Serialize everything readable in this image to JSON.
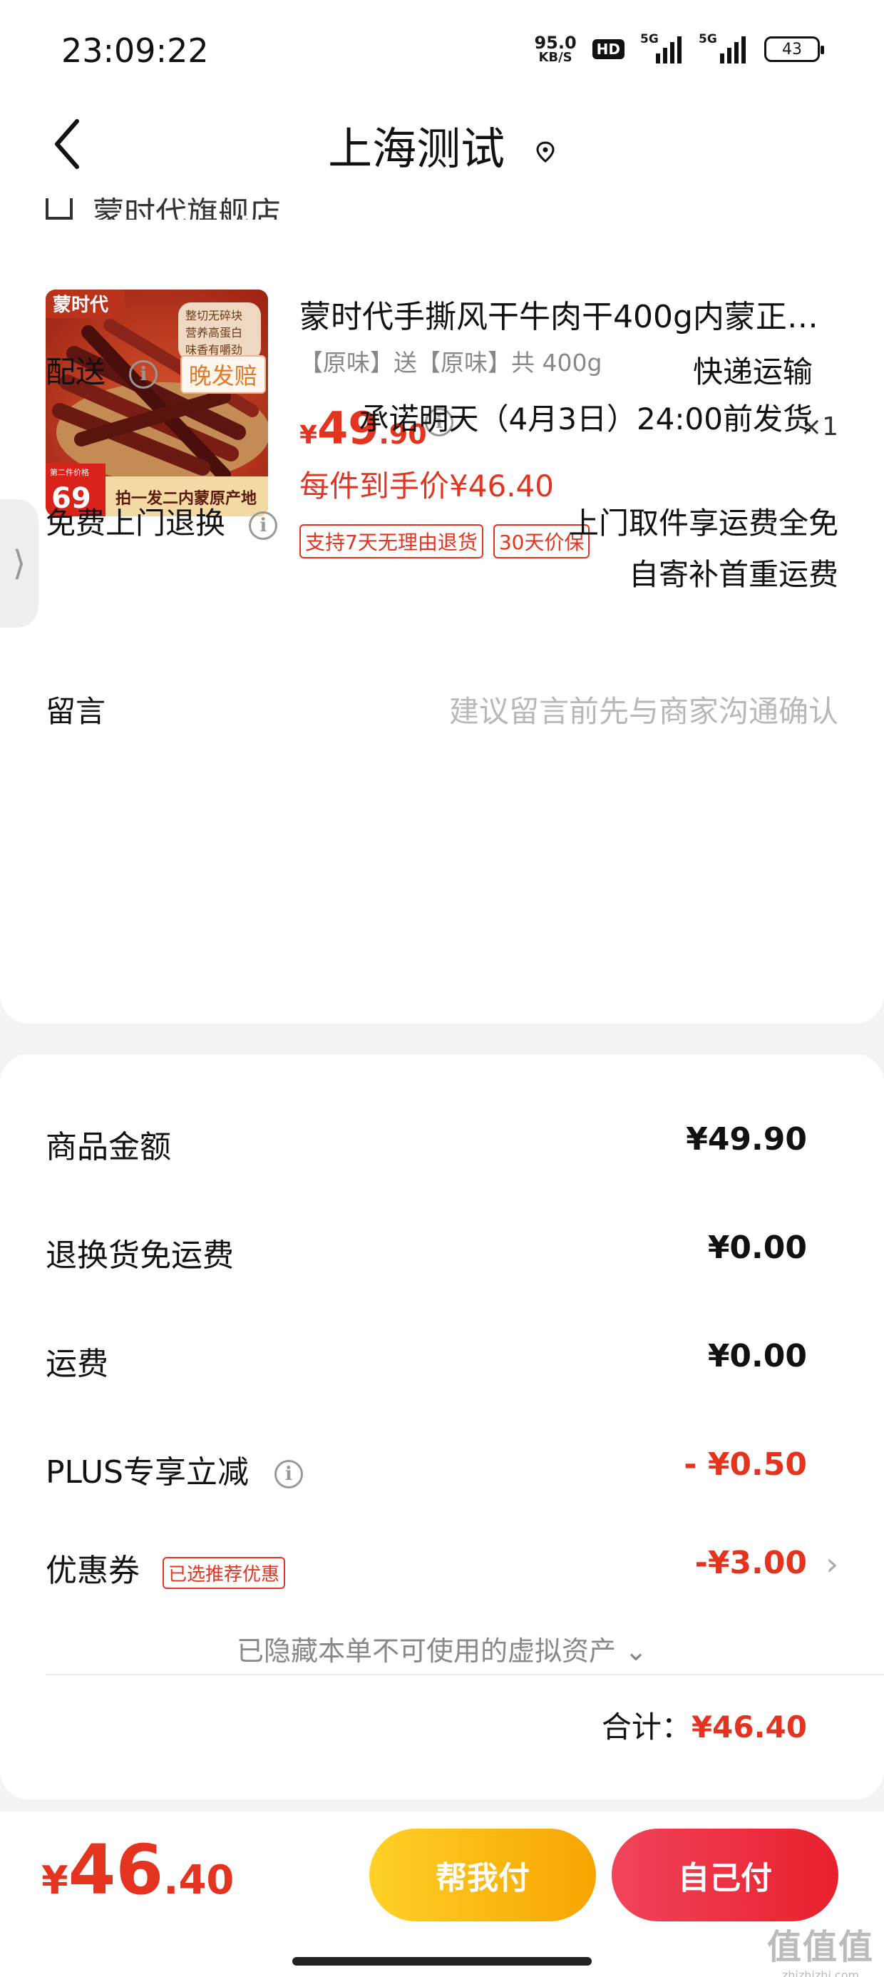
{
  "status_bar": {
    "time": "23:09:22",
    "net_speed_value": "95.0",
    "net_speed_unit": "KB/S",
    "hd_label": "HD",
    "signal1_label": "5G",
    "signal2_label": "5G",
    "battery": "43"
  },
  "header": {
    "title": "上海测试",
    "back_icon": "chevron-left-icon",
    "location_icon": "location-pin-icon"
  },
  "store": {
    "name": "蒙时代旗舰店"
  },
  "product": {
    "title": "蒙时代手撕风干牛肉干400g内蒙正…",
    "spec": "【原味】送【原味】共 400g",
    "price_symbol": "¥",
    "price_int": "49",
    "price_dec": ".90",
    "quantity": "×1",
    "unit_price": "每件到手价¥46.40",
    "tags": [
      "支持7天无理由退货",
      "30天价保"
    ],
    "image": {
      "brand": "蒙时代",
      "bubble_lines": [
        "整切无碎块",
        "营养高蛋白",
        "味香有嚼劲"
      ],
      "corner_small": "第二件价格",
      "corner_price": "69",
      "banner": "拍一发二内蒙原产地"
    }
  },
  "side_handle": {
    "glyph": "⟩"
  },
  "delivery": {
    "label": "配送",
    "badge": "晚发赔",
    "method": "快递运输",
    "promise": "承诺明天（4月3日）24:00前发货"
  },
  "returns": {
    "label": "免费上门退换",
    "line1": "上门取件享运费全免",
    "line2": "自寄补首重运费"
  },
  "message": {
    "label": "留言",
    "placeholder": "建议留言前先与商家沟通确认"
  },
  "amounts": {
    "goods_label": "商品金额",
    "goods_value": "¥49.90",
    "return_ship_label": "退换货免运费",
    "return_ship_value": "¥0.00",
    "shipping_label": "运费",
    "shipping_value": "¥0.00",
    "plus_label": "PLUS专享立减",
    "plus_value": "- ¥0.50",
    "coupon_label": "优惠券",
    "coupon_badge": "已选推荐优惠",
    "coupon_value": "-¥3.00",
    "hidden_note": "已隐藏本单不可使用的虚拟资产 ⌄",
    "total_label": "合计：",
    "total_value": "¥46.40"
  },
  "bottom": {
    "price_symbol": "¥",
    "price_int": "46",
    "price_dec": ".40",
    "help_pay": "帮我付",
    "self_pay": "自己付"
  },
  "watermark": {
    "big": "值值值",
    "small": "zhizhizhi.com"
  },
  "colors": {
    "accent_red": "#e4341f",
    "help_yellow": "#ffc107",
    "self_red": "#ec2f3f"
  }
}
